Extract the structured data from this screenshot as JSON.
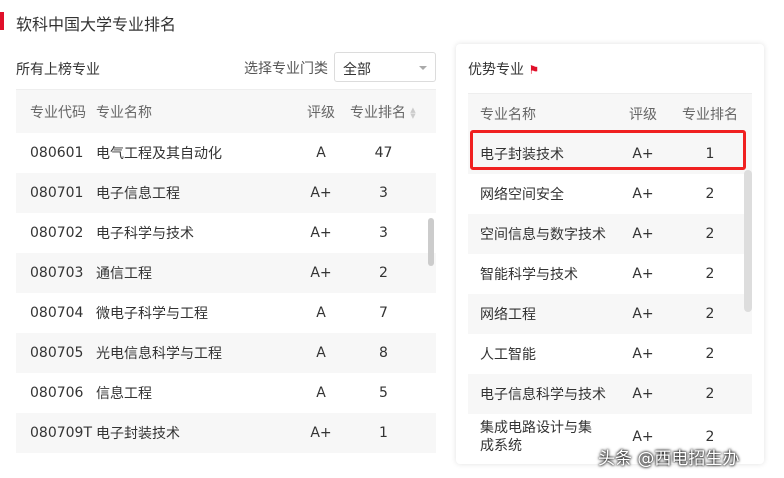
{
  "title": "软科中国大学专业排名",
  "left": {
    "heading": "所有上榜专业",
    "filter_label": "选择专业门类",
    "filter_value": "全部",
    "columns": [
      "专业代码",
      "专业名称",
      "评级",
      "专业排名"
    ],
    "rows": [
      [
        "080601",
        "电气工程及其自动化",
        "A",
        "47"
      ],
      [
        "080701",
        "电子信息工程",
        "A+",
        "3"
      ],
      [
        "080702",
        "电子科学与技术",
        "A+",
        "3"
      ],
      [
        "080703",
        "通信工程",
        "A+",
        "2"
      ],
      [
        "080704",
        "微电子科学与工程",
        "A",
        "7"
      ],
      [
        "080705",
        "光电信息科学与工程",
        "A",
        "8"
      ],
      [
        "080706",
        "信息工程",
        "A",
        "5"
      ],
      [
        "080709T",
        "电子封装技术",
        "A+",
        "1"
      ]
    ]
  },
  "right": {
    "heading": "优势专业",
    "columns": [
      "专业名称",
      "评级",
      "专业排名"
    ],
    "rows": [
      [
        "电子封装技术",
        "A+",
        "1"
      ],
      [
        "网络空间安全",
        "A+",
        "2"
      ],
      [
        "空间信息与数字技术",
        "A+",
        "2"
      ],
      [
        "智能科学与技术",
        "A+",
        "2"
      ],
      [
        "网络工程",
        "A+",
        "2"
      ],
      [
        "人工智能",
        "A+",
        "2"
      ],
      [
        "电子信息科学与技术",
        "A+",
        "2"
      ],
      [
        "集成电路设计与集成系统",
        "A+",
        "2"
      ]
    ]
  },
  "watermark": "头条 @西电招生办"
}
